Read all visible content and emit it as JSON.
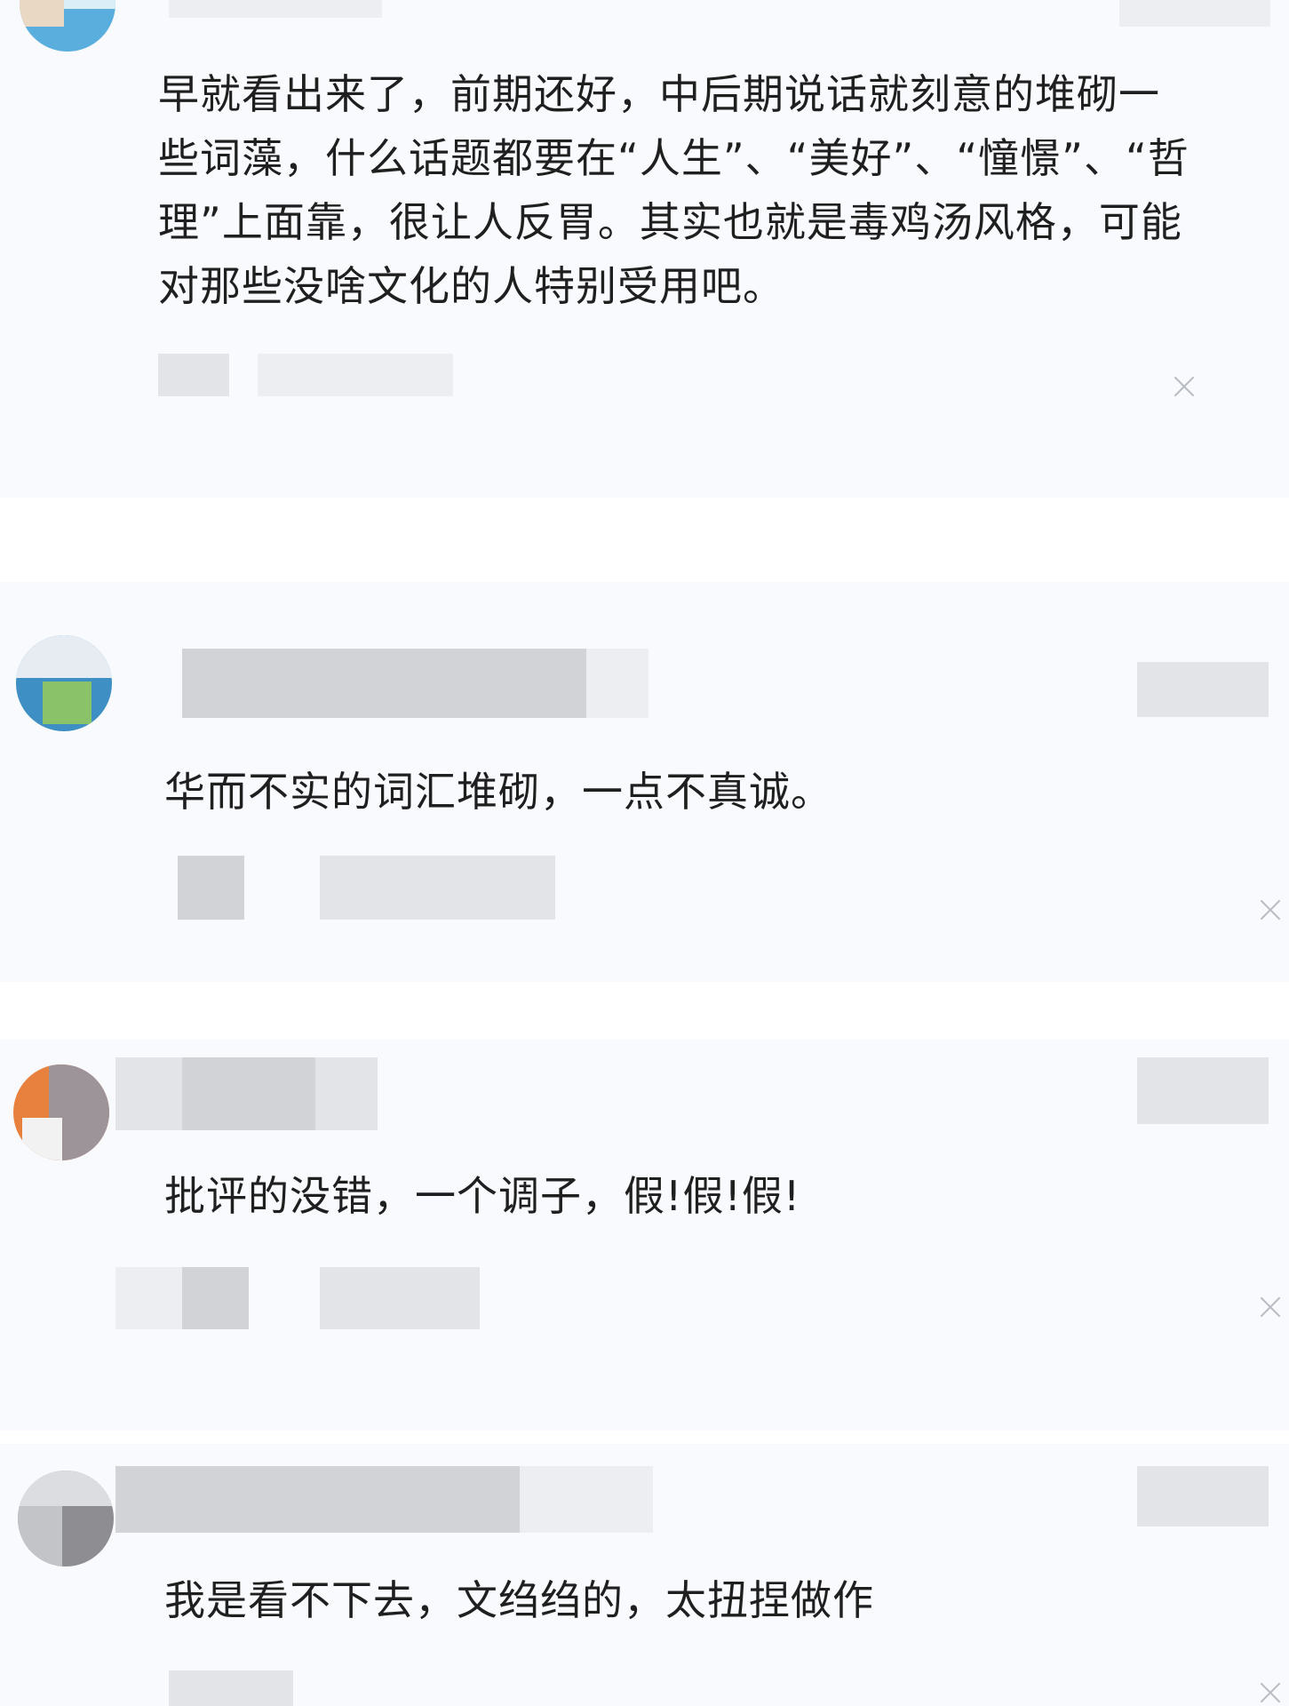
{
  "comments": [
    {
      "text": "早就看出来了，前期还好，中后期说话就刻意的堆砌一些词藻，什么话题都要在“人生”、“美好”、“憧憬”、“哲理”上面靠，很让人反胃。其实也就是毒鸡汤风格，可能对那些没啥文化的人特别受用吧。",
      "close_icon": "close-icon"
    },
    {
      "text": "华而不实的词汇堆砌，一点不真诚。",
      "close_icon": "close-icon"
    },
    {
      "text": "批评的没错，一个调子，假!假!假!",
      "close_icon": "close-icon"
    },
    {
      "text": "我是看不下去，文绉绉的，太扭捏做作",
      "close_icon": "close-icon"
    }
  ],
  "colors": {
    "card_background": "#f9fafd",
    "text": "#1f1f1f",
    "redaction": "#e3e4e8",
    "close_icon": "#b9bcc3"
  }
}
